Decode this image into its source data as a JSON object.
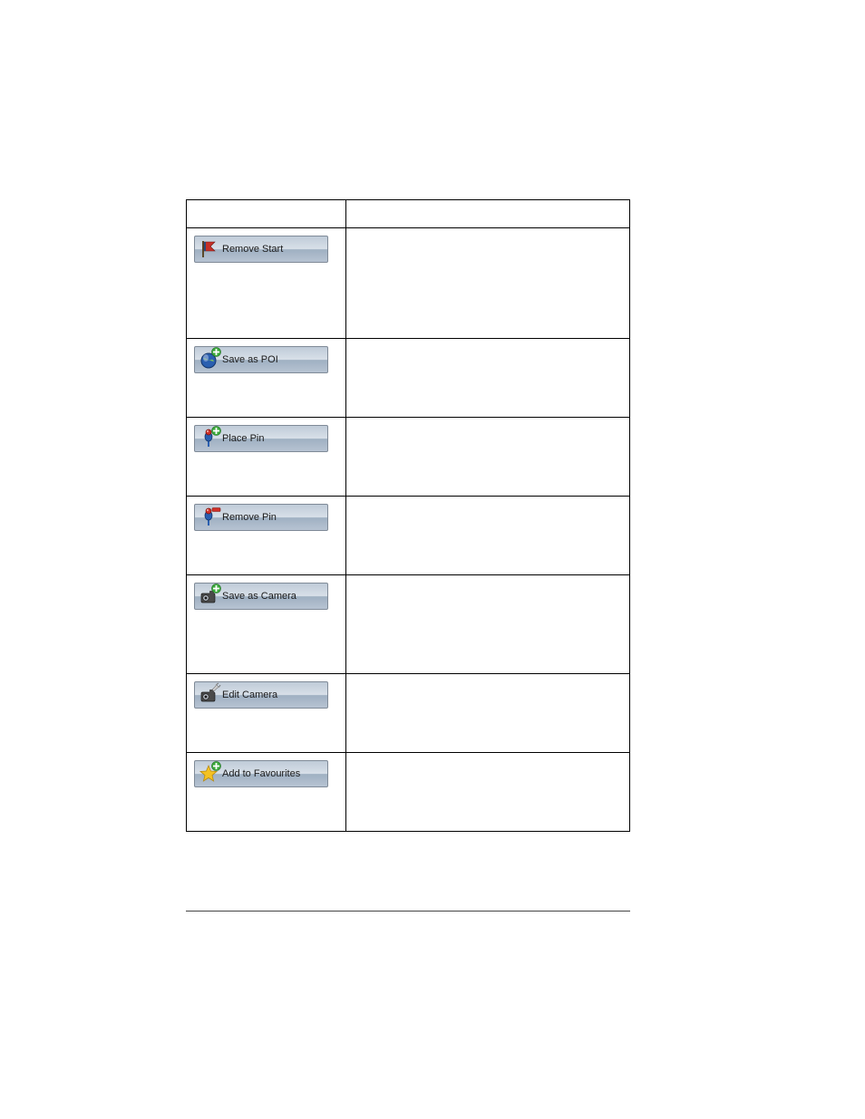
{
  "table": {
    "rows": [
      {
        "icon": "flag",
        "label": "Remove Start",
        "badge": null,
        "description": ""
      },
      {
        "icon": "globe",
        "label": "Save as POI",
        "badge": "plus",
        "description": ""
      },
      {
        "icon": "pin",
        "label": "Place Pin",
        "badge": "plus",
        "description": ""
      },
      {
        "icon": "pin",
        "label": "Remove Pin",
        "badge": "minus",
        "description": ""
      },
      {
        "icon": "camera",
        "label": "Save as Camera",
        "badge": "plus",
        "description": ""
      },
      {
        "icon": "camera",
        "label": "Edit Camera",
        "badge": "wrench",
        "description": ""
      },
      {
        "icon": "star",
        "label": "Add to Favourites",
        "badge": "plus",
        "description": ""
      }
    ]
  }
}
